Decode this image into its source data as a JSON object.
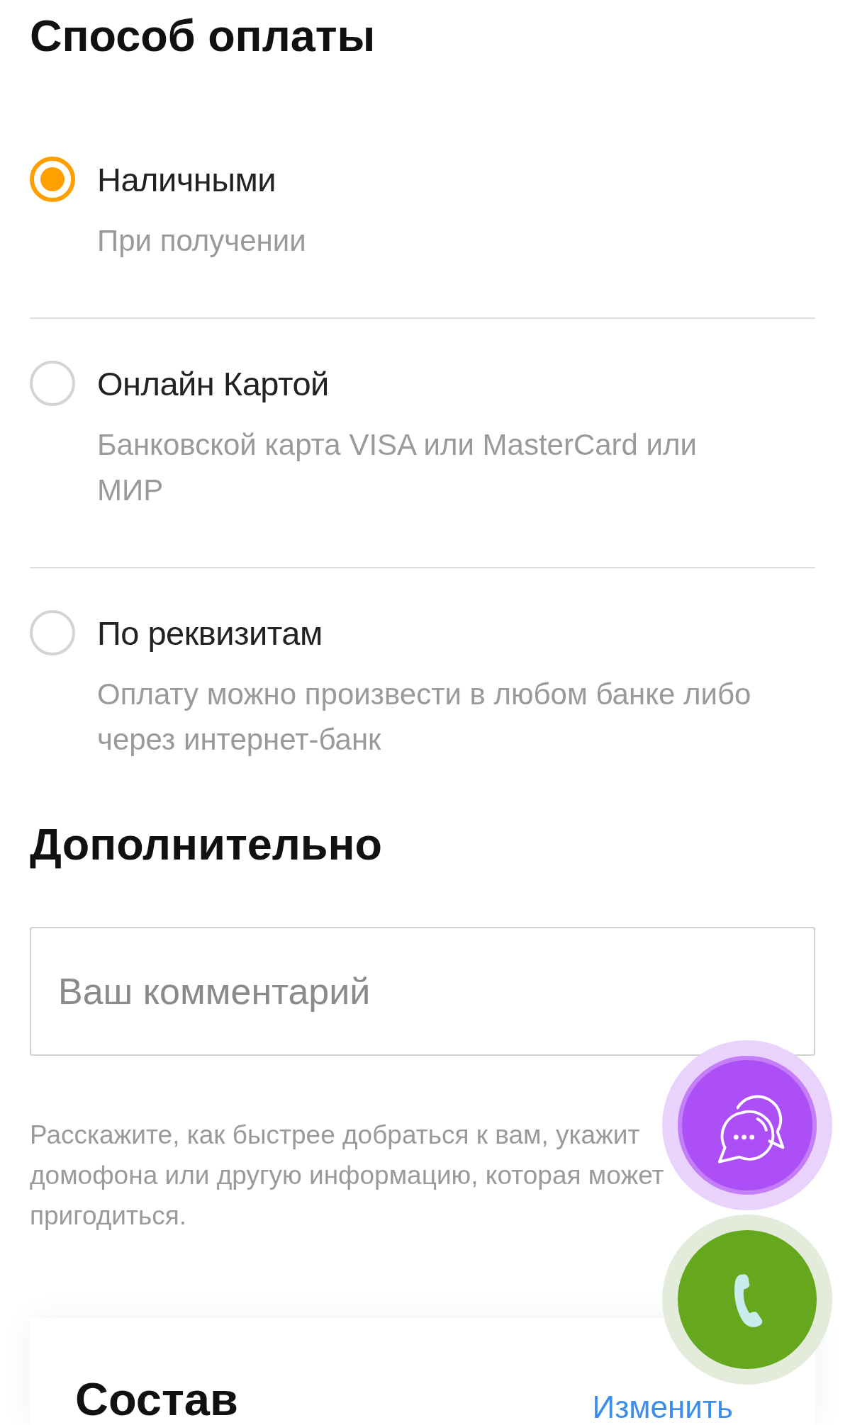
{
  "payment": {
    "title": "Способ оплаты",
    "options": [
      {
        "label": "Наличными",
        "description": "При получении",
        "selected": true
      },
      {
        "label": "Онлайн Картой",
        "description": "Банковской карта VISA или MasterCard или МИР",
        "selected": false
      },
      {
        "label": "По реквизитам",
        "description": "Оплату можно произвести в любом банке либо через интернет-банк",
        "selected": false
      }
    ]
  },
  "extra": {
    "title": "Дополнительно",
    "comment": {
      "placeholder": "Ваш комментарий"
    },
    "hint_lines": [
      "Расскажите, как быстрее добраться к вам, укажит",
      "домофона или другую информацию, которая может",
      "пригодиться."
    ]
  },
  "order": {
    "title": "Состав",
    "edit_link": "Изменить"
  }
}
